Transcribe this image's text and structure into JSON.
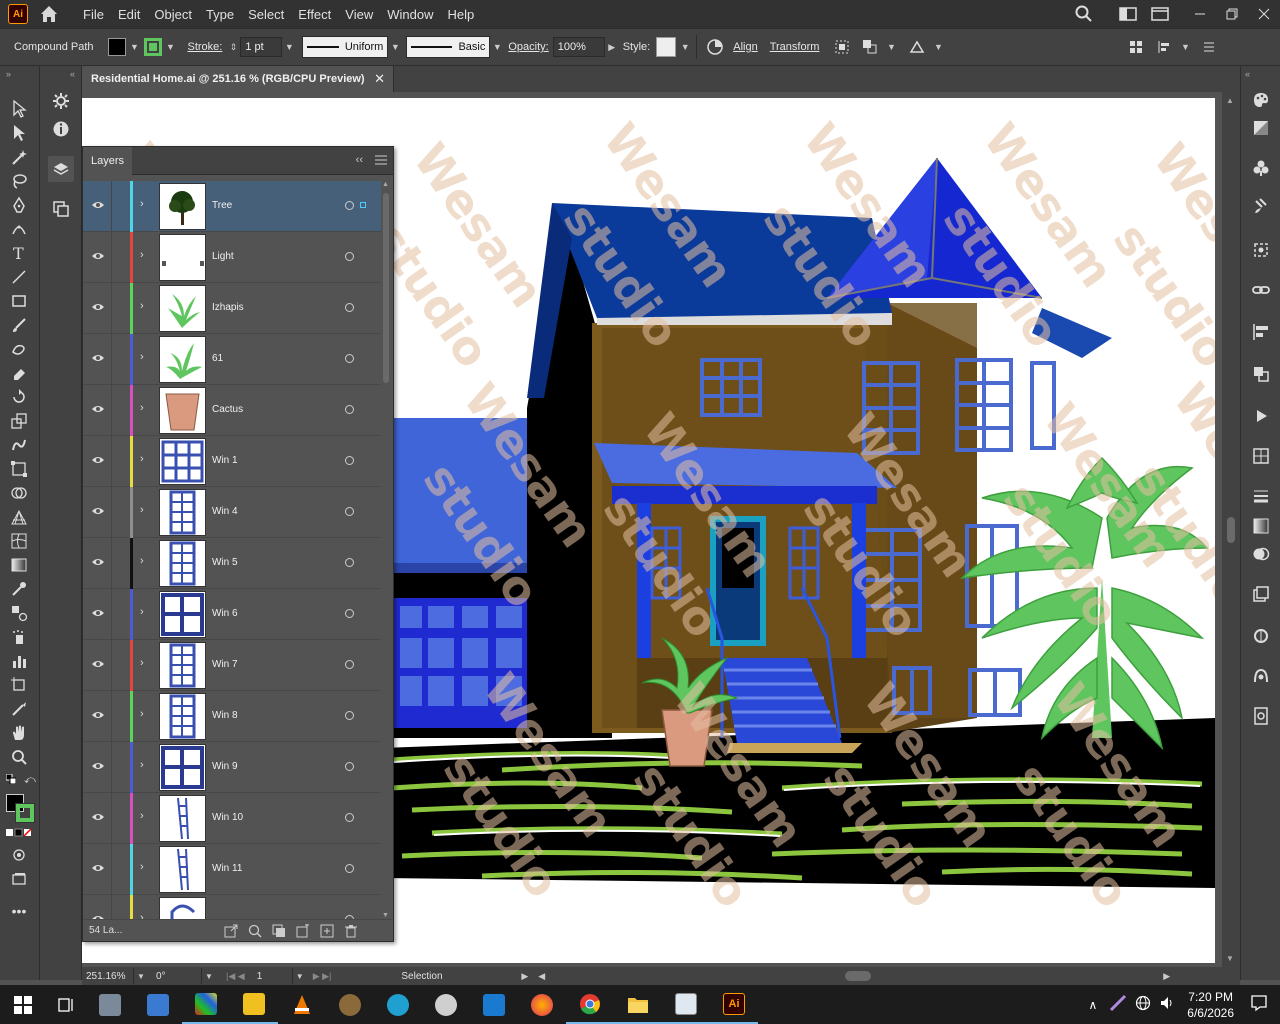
{
  "app": {
    "logo": "Ai",
    "menus": [
      "File",
      "Edit",
      "Object",
      "Type",
      "Select",
      "Effect",
      "View",
      "Window",
      "Help"
    ]
  },
  "control": {
    "object_type": "Compound Path",
    "stroke_label": "Stroke:",
    "stroke_weight": "1 pt",
    "profile_uniform": "Uniform",
    "brush_basic": "Basic",
    "opacity_label": "Opacity:",
    "opacity_value": "100%",
    "style_label": "Style:",
    "align_label": "Align",
    "transform_label": "Transform",
    "fill_color": "#000000",
    "stroke_color": "#5fc65f"
  },
  "document": {
    "tab_title": "Residential Home.ai @ 251.16 % (RGB/CPU Preview)"
  },
  "layers_panel": {
    "title": "Layers",
    "count": "54 La...",
    "layers": [
      {
        "name": "Tree",
        "color": "#4fd5e6",
        "thumb": "tree",
        "selected": true
      },
      {
        "name": "Light",
        "color": "#e6453f",
        "thumb": "light",
        "selected": false
      },
      {
        "name": "Izhapis",
        "color": "#5bd45b",
        "thumb": "plant",
        "selected": false
      },
      {
        "name": "61",
        "color": "#4e5bd6",
        "thumb": "plant2",
        "selected": false
      },
      {
        "name": "Cactus",
        "color": "#d84fc0",
        "thumb": "pot",
        "selected": false
      },
      {
        "name": "Win 1",
        "color": "#e6dc3e",
        "thumb": "win9",
        "selected": false
      },
      {
        "name": "Win 4",
        "color": "#8f8f8f",
        "thumb": "wintall",
        "selected": false
      },
      {
        "name": "Win 5",
        "color": "#111111",
        "thumb": "wintall",
        "selected": false
      },
      {
        "name": "Win 6",
        "color": "#4e5bd6",
        "thumb": "win4",
        "selected": false
      },
      {
        "name": "Win 7",
        "color": "#e6453f",
        "thumb": "wintall",
        "selected": false
      },
      {
        "name": "Win 8",
        "color": "#5bd45b",
        "thumb": "wintall",
        "selected": false
      },
      {
        "name": "Win 9",
        "color": "#4e5bd6",
        "thumb": "win4",
        "selected": false
      },
      {
        "name": "Win 10",
        "color": "#d84fc0",
        "thumb": "ladder",
        "selected": false
      },
      {
        "name": "Win 11",
        "color": "#4fd5e6",
        "thumb": "ladder",
        "selected": false
      },
      {
        "name": "",
        "color": "#e6dc3e",
        "thumb": "arch",
        "selected": false
      }
    ]
  },
  "status": {
    "zoom": "251.16%",
    "rotation": "0°",
    "artboard": "1",
    "tool": "Selection"
  },
  "artwork": {
    "watermark": "Wesam studio"
  },
  "taskbar": {
    "time": "7:20 PM",
    "date": "6/6/2026"
  }
}
